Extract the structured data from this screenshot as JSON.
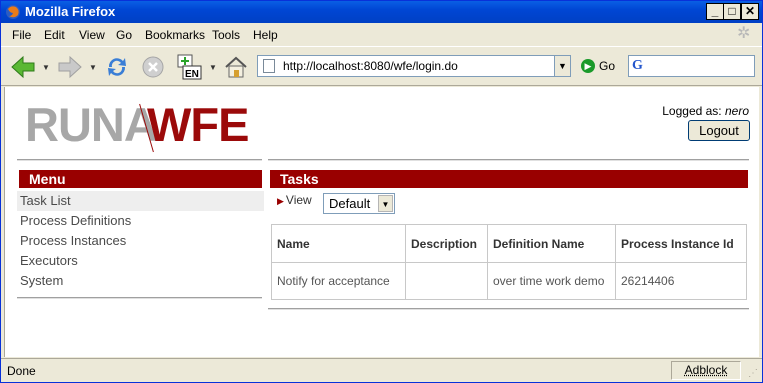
{
  "window": {
    "title": "Mozilla Firefox",
    "buttons": {
      "minimize": "_",
      "maximize": "□",
      "close": "✕"
    }
  },
  "menubar": [
    "File",
    "Edit",
    "View",
    "Go",
    "Bookmarks",
    "Tools",
    "Help"
  ],
  "navbar": {
    "icons": [
      "back-icon",
      "forward-icon",
      "reload-icon",
      "stop-icon",
      "language-icon",
      "home-icon"
    ],
    "url": "http://localhost:8080/wfe/login.do",
    "go_label": "Go",
    "search_engine_icon": "G"
  },
  "header": {
    "logo": {
      "part1": "RUNA",
      "part2": "WFE"
    },
    "logged_as_label": "Logged as: ",
    "user": "nero",
    "logout_label": "Logout"
  },
  "menu": {
    "title": "Menu",
    "items": [
      "Task List",
      "Process Definitions",
      "Process Instances",
      "Executors",
      "System"
    ],
    "active_index": 0
  },
  "tasks": {
    "title": "Tasks",
    "view_label": "View",
    "view_value": "Default",
    "columns": [
      "Name",
      "Description",
      "Definition Name",
      "Process Instance Id"
    ],
    "rows": [
      {
        "name": "Notify for acceptance",
        "description": "",
        "definition": "over time work demo",
        "instance_id": "26214406"
      }
    ]
  },
  "status": {
    "text": "Done",
    "adblock": "Adblock"
  },
  "colors": {
    "accent": "#990000",
    "logo_gray": "#a7a7a7",
    "titlebar": "#0046d4"
  }
}
